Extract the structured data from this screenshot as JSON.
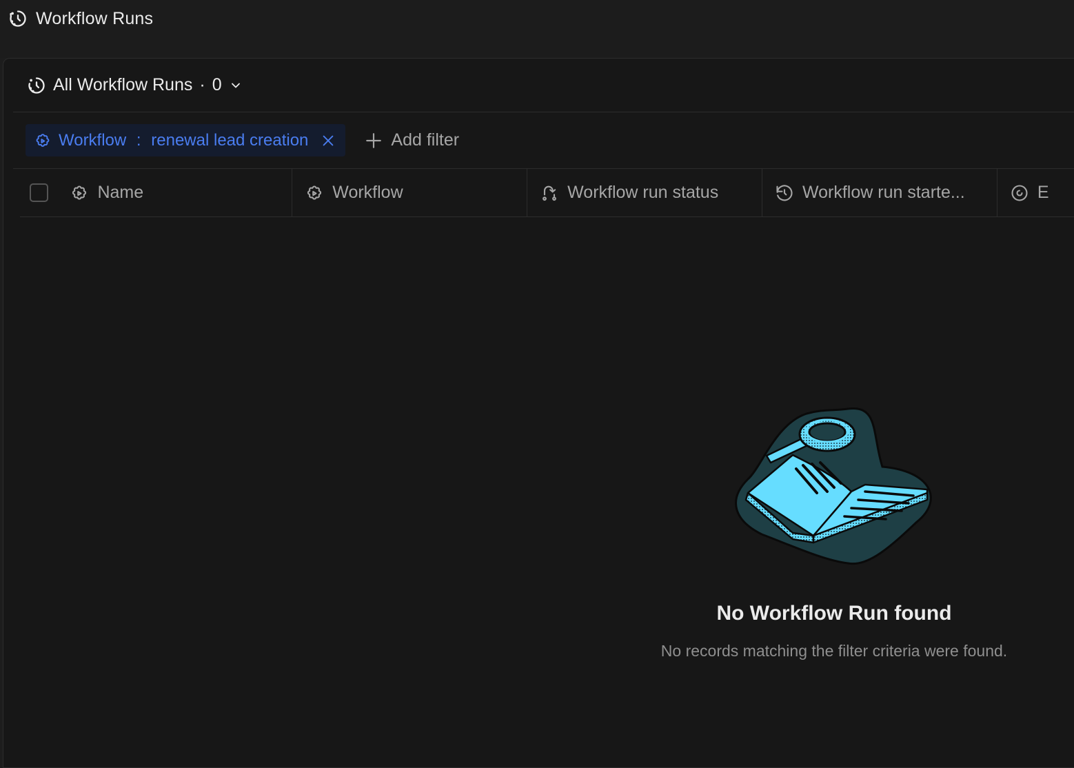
{
  "header": {
    "title": "Workflow Runs",
    "icon": "history-icon"
  },
  "view": {
    "label": "All Workflow Runs",
    "separator": "·",
    "count": "0",
    "icon": "history-icon",
    "dropdown_icon": "chevron-down-icon"
  },
  "filters": {
    "chip": {
      "field": "Workflow",
      "separator": " : ",
      "value": "renewal lead creation",
      "icon": "settings-automation-icon",
      "remove_icon": "close-icon"
    },
    "add_filter_label": "Add filter",
    "add_icon": "plus-icon"
  },
  "table": {
    "columns": [
      {
        "label": "Name",
        "icon": "settings-automation-icon"
      },
      {
        "label": "Workflow",
        "icon": "settings-automation-icon"
      },
      {
        "label": "Workflow run status",
        "icon": "status-change-icon"
      },
      {
        "label": "Workflow run starte...",
        "icon": "history-icon"
      },
      {
        "label": "E",
        "icon": "target-icon"
      }
    ]
  },
  "empty_state": {
    "title": "No Workflow Run found",
    "subtitle": "No records matching the filter criteria were found.",
    "illustration": "book-magnifier-illustration"
  },
  "colors": {
    "accent": "#4a7df0",
    "illustration_fill": "#66ddff",
    "illustration_bg": "#1e3f45"
  }
}
